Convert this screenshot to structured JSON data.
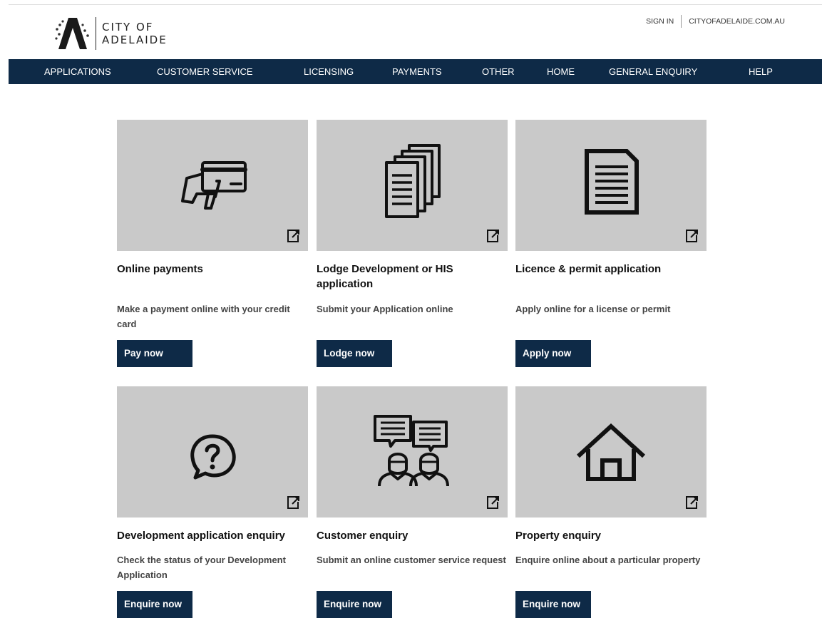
{
  "brand": {
    "line1": "CITY OF",
    "line2": "ADELAIDE"
  },
  "utility": {
    "sign_in": "SIGN IN",
    "site_link": "CITYOFADELAIDE.COM.AU"
  },
  "nav": [
    "APPLICATIONS",
    "CUSTOMER SERVICE",
    "LICENSING",
    "PAYMENTS",
    "OTHER",
    "HOME",
    "GENERAL ENQUIRY",
    "HELP"
  ],
  "cards": [
    {
      "title": "Online payments",
      "description": "Make a payment online with your credit card",
      "button": "Pay now",
      "icon": "credit-card-icon"
    },
    {
      "title": "Lodge Development or HIS application",
      "description": "Submit your Application online",
      "button": "Lodge now",
      "icon": "documents-stack-icon"
    },
    {
      "title": "Licence & permit application",
      "description": "Apply online for a license or permit",
      "button": "Apply now",
      "icon": "document-icon"
    },
    {
      "title": "Development application enquiry",
      "description": "Check the status of your Development Application",
      "button": "Enquire now",
      "icon": "question-bubble-icon"
    },
    {
      "title": "Customer enquiry",
      "description": "Submit an online customer service request",
      "button": "Enquire now",
      "icon": "customers-chat-icon"
    },
    {
      "title": "Property enquiry",
      "description": "Enquire online about a particular property",
      "button": "Enquire now",
      "icon": "house-icon"
    }
  ],
  "colors": {
    "navy": "#0e2a47",
    "tile": "#c9c9c9"
  }
}
